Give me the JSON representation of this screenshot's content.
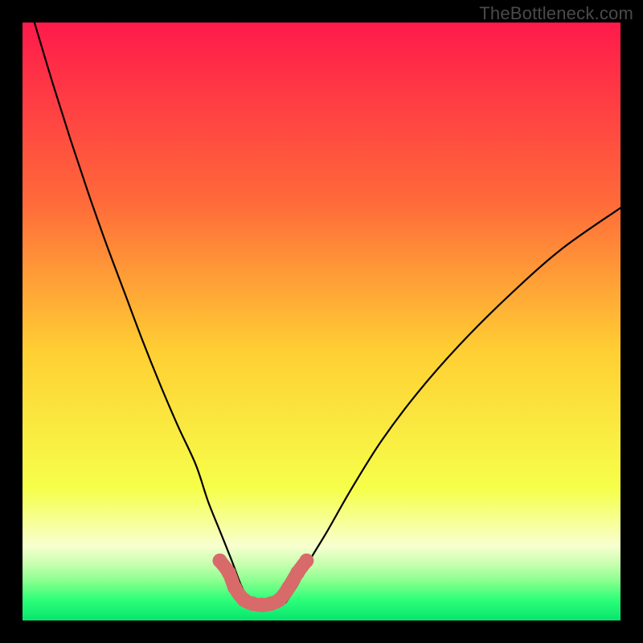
{
  "watermark": "TheBottleneck.com",
  "chart_data": {
    "type": "line",
    "title": "",
    "xlabel": "",
    "ylabel": "",
    "xlim": [
      0,
      100
    ],
    "ylim": [
      0,
      100
    ],
    "gradient_stops": [
      {
        "offset": 0,
        "color": "#ff1a4b"
      },
      {
        "offset": 0.3,
        "color": "#ff6a3a"
      },
      {
        "offset": 0.55,
        "color": "#ffcf33"
      },
      {
        "offset": 0.78,
        "color": "#f6ff4a"
      },
      {
        "offset": 0.875,
        "color": "#f8ffd0"
      },
      {
        "offset": 0.905,
        "color": "#caffb0"
      },
      {
        "offset": 0.935,
        "color": "#86ff8e"
      },
      {
        "offset": 0.965,
        "color": "#2fff79"
      },
      {
        "offset": 1.0,
        "color": "#06e56d"
      }
    ],
    "series": [
      {
        "name": "left-curve",
        "x": [
          2,
          5,
          8,
          11,
          14,
          17,
          20,
          23,
          26,
          29,
          31,
          33,
          35,
          36.5,
          38
        ],
        "y": [
          100,
          90,
          80.5,
          71.5,
          63,
          55,
          47,
          39.5,
          32.5,
          26,
          20,
          15,
          10,
          6,
          3
        ]
      },
      {
        "name": "right-curve",
        "x": [
          44,
          46,
          48,
          51,
          55,
          60,
          66,
          73,
          81,
          90,
          100
        ],
        "y": [
          3,
          6,
          10,
          15,
          22,
          30,
          38,
          46,
          54,
          62,
          69
        ]
      },
      {
        "name": "bottom-markers",
        "x": [
          33,
          34.5,
          35.5,
          37,
          38.5,
          40,
          41.5,
          43,
          44.5,
          46,
          47.5
        ],
        "y": [
          10,
          8,
          5.5,
          3.5,
          2.8,
          2.6,
          2.8,
          3.5,
          5.5,
          8,
          10
        ],
        "marker_color": "#d86a6a",
        "marker_radius_px": 9
      }
    ]
  }
}
